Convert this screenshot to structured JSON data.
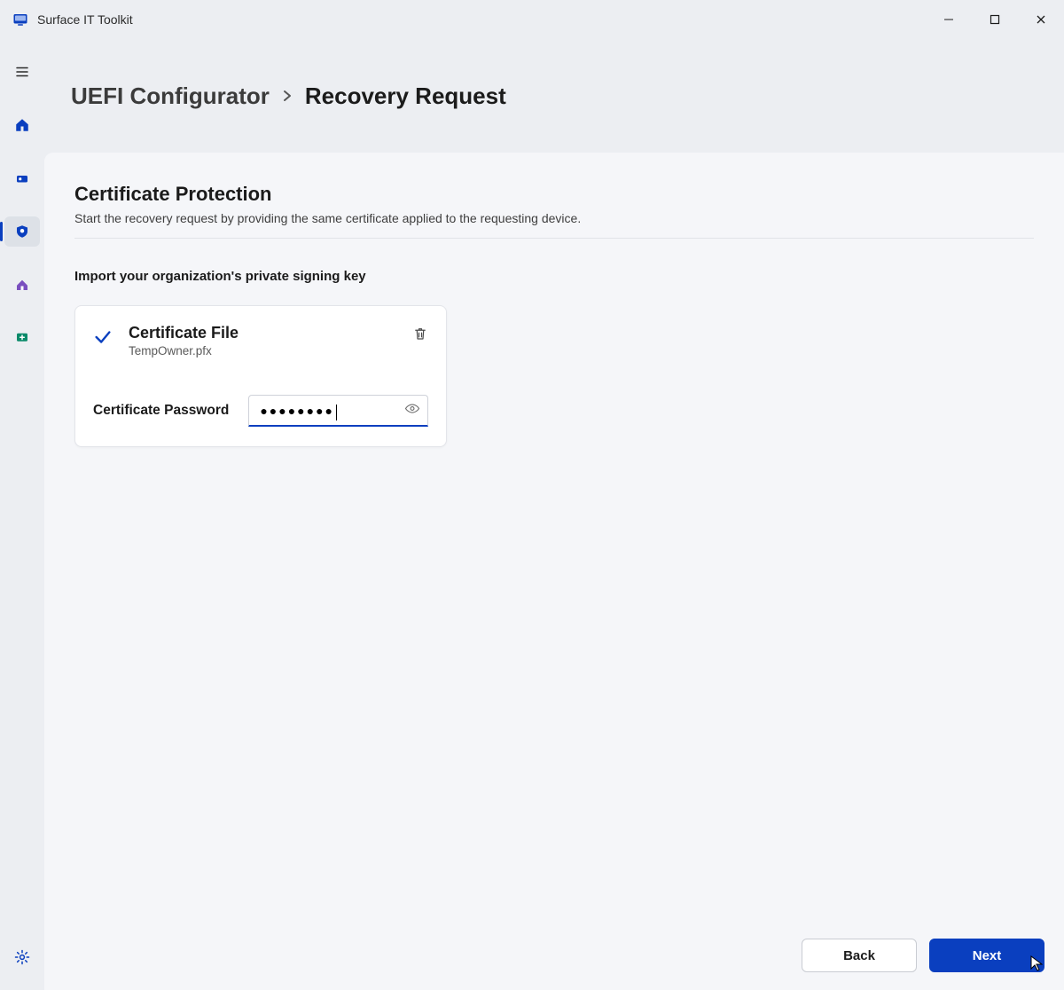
{
  "app": {
    "title": "Surface IT Toolkit"
  },
  "breadcrumb": {
    "root": "UEFI Configurator",
    "current": "Recovery Request"
  },
  "section": {
    "title": "Certificate Protection",
    "sub": "Start the recovery request by providing the same certificate applied to the requesting device."
  },
  "instruction": "Import your organization's private signing key",
  "cert": {
    "file_label": "Certificate File",
    "file_name": "TempOwner.pfx",
    "password_label": "Certificate Password",
    "password_value_masked": "●●●●●●●●"
  },
  "footer": {
    "back": "Back",
    "next": "Next"
  },
  "colors": {
    "accent": "#0a3fbf"
  }
}
